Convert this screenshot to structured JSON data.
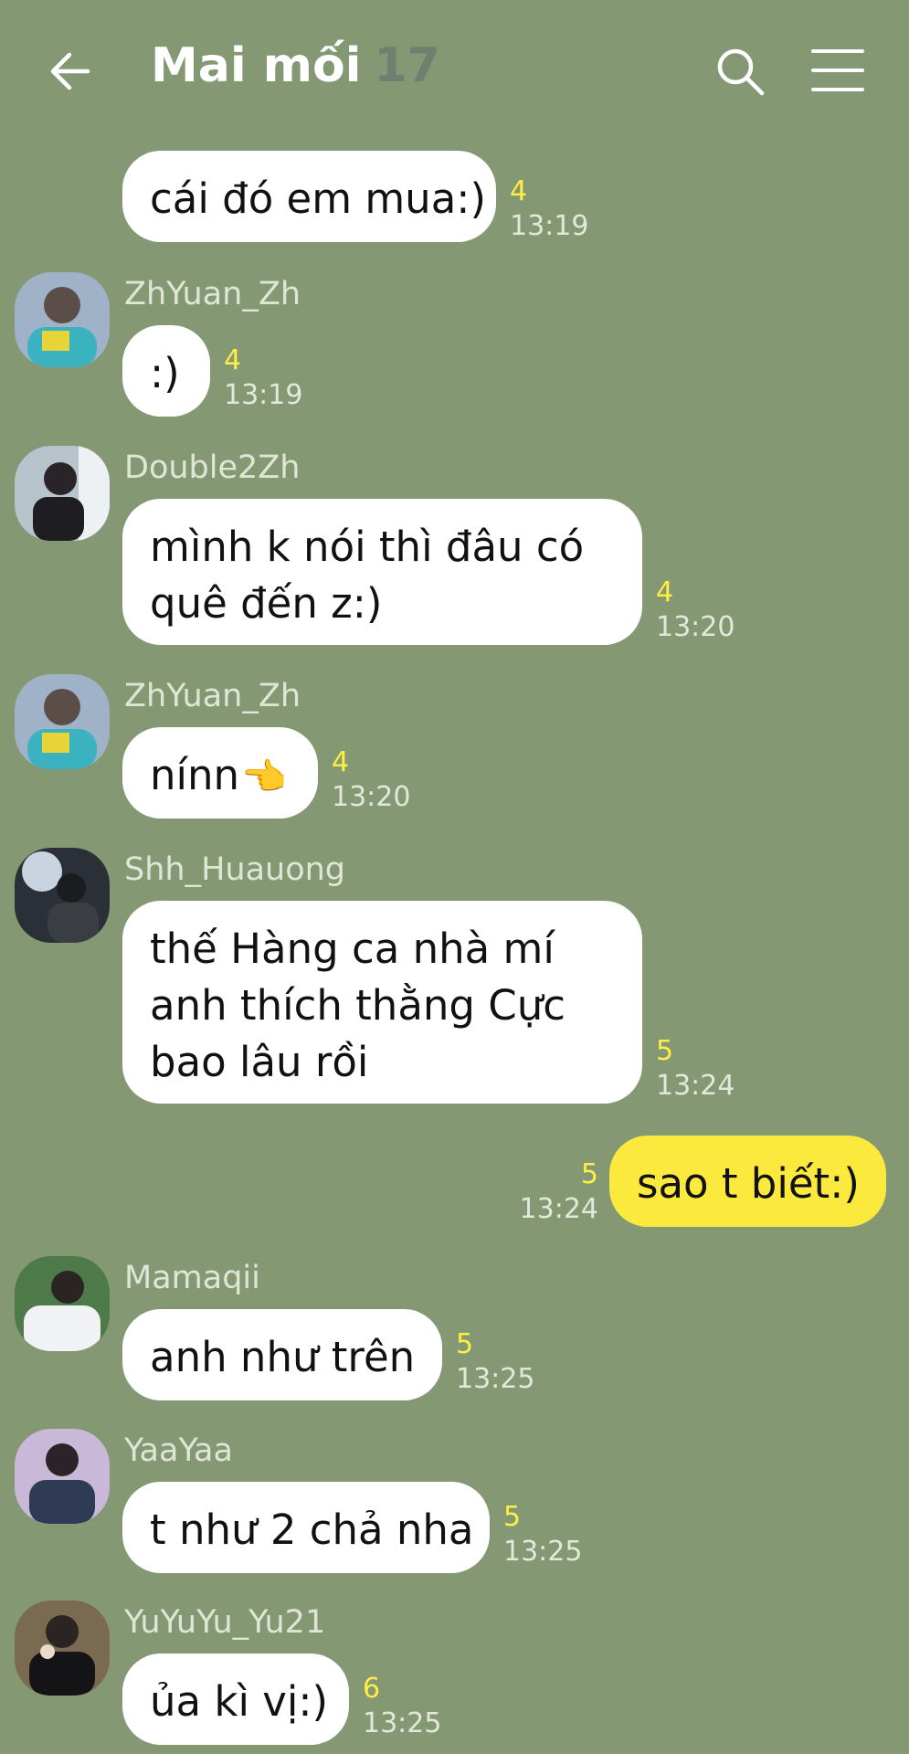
{
  "header": {
    "title": "Mai mối",
    "member_count": "17"
  },
  "messages": [
    {
      "sender": "",
      "text": "cái đó em mua:)",
      "read": "4",
      "time": "13:19"
    },
    {
      "sender": "ZhYuan_Zh",
      "text": ":)",
      "read": "4",
      "time": "13:19"
    },
    {
      "sender": "Double2Zh",
      "lines": [
        "mình k nói thì đâu có",
        "quê đến z:)"
      ],
      "read": "4",
      "time": "13:20"
    },
    {
      "sender": "ZhYuan_Zh",
      "text": "nínn",
      "read": "4",
      "time": "13:20"
    },
    {
      "sender": "Shh_Huauong",
      "lines": [
        "thế Hàng ca nhà mí",
        "anh thích thằng Cực",
        "bao lâu rồi"
      ],
      "read": "5",
      "time": "13:24"
    },
    {
      "sender": "",
      "text": "sao t biết:)",
      "read": "5",
      "time": "13:24"
    },
    {
      "sender": "Mamaqii",
      "text": "anh như trên",
      "read": "5",
      "time": "13:25"
    },
    {
      "sender": "YaaYaa",
      "text": "t như 2 chả nha",
      "read": "5",
      "time": "13:25"
    },
    {
      "sender": "YuYuYu_Yu21",
      "text": "ủa kì vị:)",
      "read": "6",
      "time": "13:25"
    }
  ],
  "colors": {
    "background": "#859874",
    "own_bubble": "#fbea3d",
    "other_bubble": "#ffffff",
    "read_count": "#ffee44"
  },
  "icons": [
    "back-arrow-icon",
    "search-icon",
    "menu-icon",
    "hand-emoji-icon"
  ]
}
